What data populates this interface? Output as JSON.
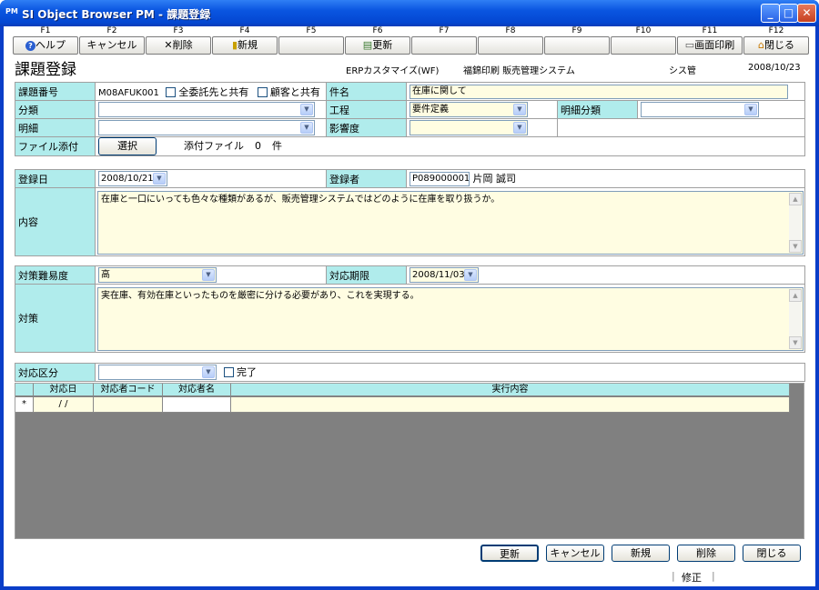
{
  "window": {
    "icon": "PM",
    "title": "SI Object Browser PM - 課題登録"
  },
  "fkeys": [
    {
      "key": "F1",
      "label": "ヘルプ",
      "icon": "help-icon"
    },
    {
      "key": "F2",
      "label": "キャンセル",
      "icon": ""
    },
    {
      "key": "F3",
      "label": "削除",
      "icon": "delete-x-icon"
    },
    {
      "key": "F4",
      "label": "新規",
      "icon": "new-document-icon"
    },
    {
      "key": "F5",
      "label": "",
      "icon": ""
    },
    {
      "key": "F6",
      "label": "更新",
      "icon": "update-document-icon"
    },
    {
      "key": "F7",
      "label": "",
      "icon": ""
    },
    {
      "key": "F8",
      "label": "",
      "icon": ""
    },
    {
      "key": "F9",
      "label": "",
      "icon": ""
    },
    {
      "key": "F10",
      "label": "",
      "icon": ""
    },
    {
      "key": "F11",
      "label": "画面印刷",
      "icon": "printer-icon"
    },
    {
      "key": "F12",
      "label": "閉じる",
      "icon": "home-icon"
    }
  ],
  "header": {
    "page_title": "課題登録",
    "project": "ERPカスタマイズ(WF)",
    "company_system": "福錦印刷 販売管理システム",
    "user": "シス管",
    "date": "2008/10/23"
  },
  "issue": {
    "number_label": "課題番号",
    "number_value": "M08AFUK001",
    "share_contractor_label": "全委託先と共有",
    "share_customer_label": "顧客と共有",
    "subject_label": "件名",
    "subject_value": "在庫に関して",
    "category_label": "分類",
    "category_value": "",
    "process_label": "工程",
    "process_value": "要件定義",
    "detail_category_label": "明細分類",
    "detail_category_value": "",
    "detail_label": "明細",
    "detail_value": "",
    "impact_label": "影響度",
    "impact_value": "",
    "attachment_label": "ファイル添付",
    "select_button": "選択",
    "attached_files_label": "添付ファイル",
    "attached_count": "0",
    "count_unit": "件"
  },
  "registration": {
    "date_label": "登録日",
    "date_value": "2008/10/21",
    "registrant_label": "登録者",
    "registrant_code": "P089000001",
    "registrant_name": "片岡 誠司",
    "content_label": "内容",
    "content_value": "在庫と一口にいっても色々な種類があるが、販売管理システムではどのように在庫を取り扱うか。"
  },
  "countermeasure": {
    "difficulty_label": "対策難易度",
    "difficulty_value": "高",
    "deadline_label": "対応期限",
    "deadline_value": "2008/11/03",
    "measure_label": "対策",
    "measure_value": "実在庫、有効在庫といったものを厳密に分ける必要があり、これを実現する。"
  },
  "response": {
    "type_label": "対応区分",
    "type_value": "",
    "complete_label": "完了",
    "columns": [
      "対応日",
      "対応者コード",
      "対応者名",
      "実行内容"
    ],
    "new_row": {
      "marker": "*",
      "date": " /  /",
      "code": "",
      "name": "",
      "content": ""
    }
  },
  "bottom_buttons": {
    "update": "更新",
    "cancel": "キャンセル",
    "new": "新規",
    "delete": "削除",
    "close": "閉じる"
  },
  "status_bar": {
    "mode": "修正"
  }
}
